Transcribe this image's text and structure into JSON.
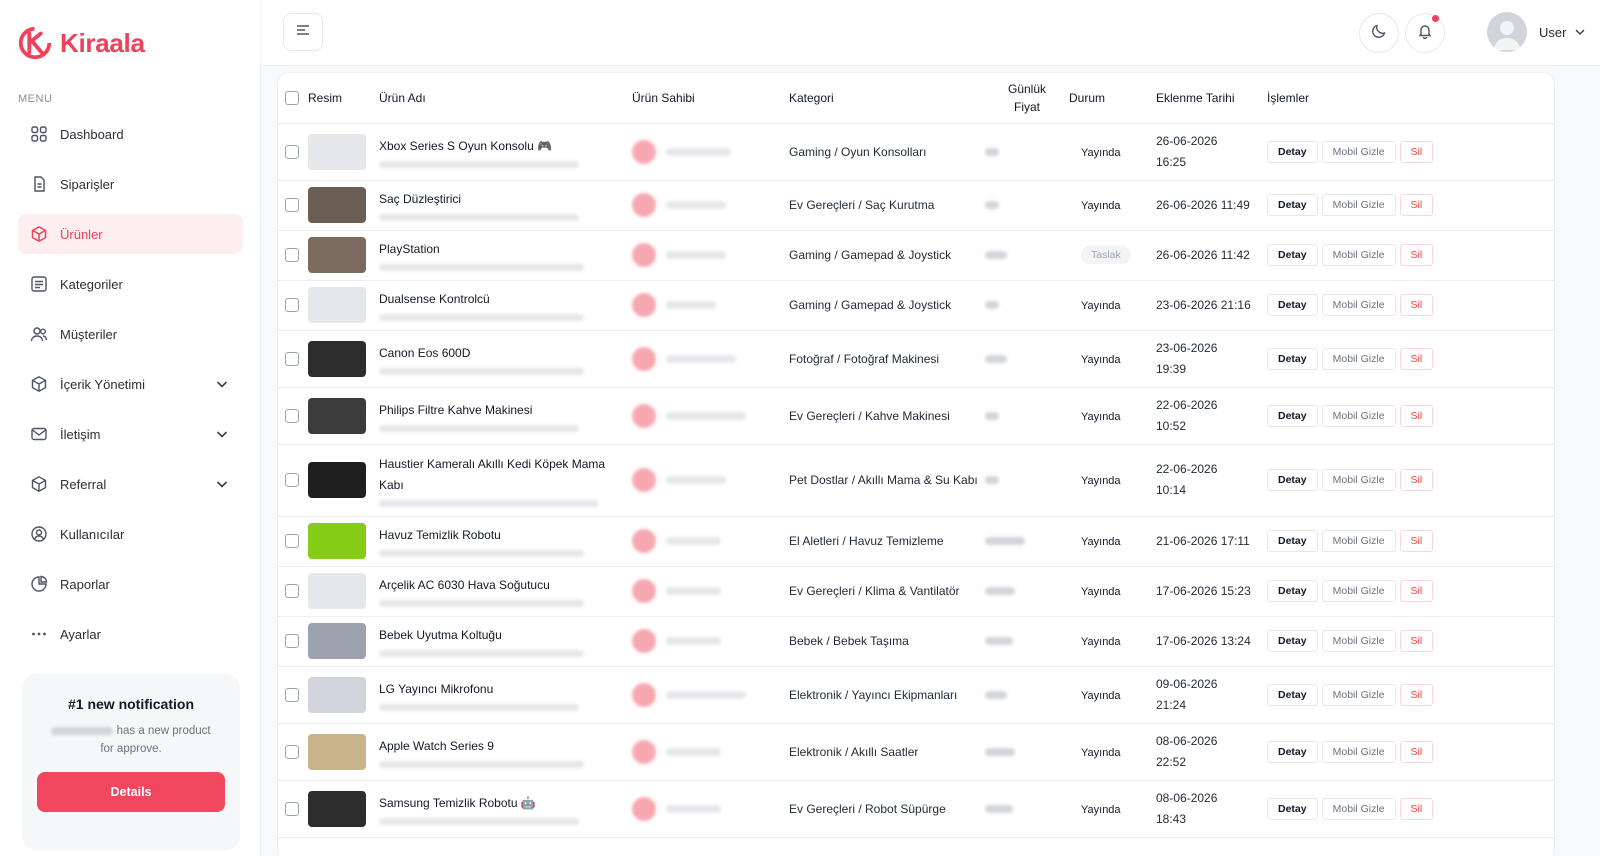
{
  "brand": {
    "name": "Kiraala",
    "color": "#f0405a"
  },
  "sidebar": {
    "caption": "MENU",
    "items": [
      {
        "label": "Dashboard",
        "icon": "grid-icon",
        "active": false,
        "expandable": false
      },
      {
        "label": "Siparişler",
        "icon": "clipboard-icon",
        "active": false,
        "expandable": false
      },
      {
        "label": "Ürünler",
        "icon": "box-icon",
        "active": true,
        "expandable": false
      },
      {
        "label": "Kategoriler",
        "icon": "list-icon",
        "active": false,
        "expandable": false
      },
      {
        "label": "Müşteriler",
        "icon": "users-icon",
        "active": false,
        "expandable": false
      },
      {
        "label": "İçerik Yönetimi",
        "icon": "cube-icon",
        "active": false,
        "expandable": true
      },
      {
        "label": "İletişim",
        "icon": "mail-icon",
        "active": false,
        "expandable": true
      },
      {
        "label": "Referral",
        "icon": "cube-icon",
        "active": false,
        "expandable": true
      },
      {
        "label": "Kullanıcılar",
        "icon": "user-circle-icon",
        "active": false,
        "expandable": false
      },
      {
        "label": "Raporlar",
        "icon": "pie-chart-icon",
        "active": false,
        "expandable": false
      },
      {
        "label": "Ayarlar",
        "icon": "more-dots-icon",
        "active": false,
        "expandable": false
      }
    ],
    "notification": {
      "title": "#1 new notification",
      "body_text": "has a new product",
      "body_text2": "for approve.",
      "button": "Details"
    }
  },
  "header": {
    "user_name": "User"
  },
  "table": {
    "columns": {
      "resim": "Resim",
      "urun_adi": "Ürün Adı",
      "urun_sahibi": "Ürün Sahibi",
      "kategori": "Kategori",
      "fiyat_line1": "Günlük",
      "fiyat_line2": "Fiyat",
      "durum": "Durum",
      "tarih": "Eklenme Tarihi",
      "islemler": "İşlemler"
    },
    "actions": {
      "detay": "Detay",
      "gizle": "Mobil Gizle",
      "sil": "Sil"
    },
    "rows": [
      {
        "name": "Xbox Series S Oyun Konsolu 🎮",
        "category": "Gaming / Oyun Konsolları",
        "status": "Yayında",
        "date1": "26-06-2026",
        "date2": "16:25",
        "thumb": "#e5e7eb"
      },
      {
        "name": "Saç Düzleştirici",
        "category": "Ev Gereçleri / Saç Kurutma",
        "status": "Yayında",
        "date1": "26-06-2026 11:49",
        "date2": "",
        "thumb": "#6b5e54"
      },
      {
        "name": "PlayStation",
        "category": "Gaming / Gamepad & Joystick",
        "status": "Taslak",
        "date1": "26-06-2026 11:42",
        "date2": "",
        "thumb": "#7b6a5e"
      },
      {
        "name": "Dualsense Kontrolcü",
        "category": "Gaming / Gamepad & Joystick",
        "status": "Yayında",
        "date1": "23-06-2026 21:16",
        "date2": "",
        "thumb": "#e5e7eb"
      },
      {
        "name": "Canon Eos 600D",
        "category": "Fotoğraf / Fotoğraf Makinesi",
        "status": "Yayında",
        "date1": "23-06-2026",
        "date2": "19:39",
        "thumb": "#2d2d2d"
      },
      {
        "name": "Philips Filtre Kahve Makinesi",
        "category": "Ev Gereçleri / Kahve Makinesi",
        "status": "Yayında",
        "date1": "22-06-2026",
        "date2": "10:52",
        "thumb": "#3b3b3b"
      },
      {
        "name": "Haustier Kameralı Akıllı Kedi Köpek Mama Kabı",
        "category": "Pet Dostlar / Akıllı Mama & Su Kabı",
        "status": "Yayında",
        "date1": "22-06-2026",
        "date2": "10:14",
        "thumb": "#1f1f1f"
      },
      {
        "name": "Havuz Temizlik Robotu",
        "category": "El Aletleri / Havuz Temizleme",
        "status": "Yayında",
        "date1": "21-06-2026 17:11",
        "date2": "",
        "thumb": "#84cc16"
      },
      {
        "name": "Arçelik AC 6030 Hava Soğutucu",
        "category": "Ev Gereçleri / Klima & Vantilatör",
        "status": "Yayında",
        "date1": "17-06-2026 15:23",
        "date2": "",
        "thumb": "#e5e7eb"
      },
      {
        "name": "Bebek Uyutma Koltuğu",
        "category": "Bebek / Bebek Taşıma",
        "status": "Yayında",
        "date1": "17-06-2026 13:24",
        "date2": "",
        "thumb": "#9ca3af"
      },
      {
        "name": "LG Yayıncı Mikrofonu",
        "category": "Elektronik / Yayıncı Ekipmanları",
        "status": "Yayında",
        "date1": "09-06-2026",
        "date2": "21:24",
        "thumb": "#d1d5db"
      },
      {
        "name": "Apple Watch Series 9",
        "category": "Elektronik / Akıllı Saatler",
        "status": "Yayında",
        "date1": "08-06-2026",
        "date2": "22:52",
        "thumb": "#c8b48a"
      },
      {
        "name": "Samsung Temizlik Robotu 🤖",
        "category": "Ev Gereçleri / Robot Süpürge",
        "status": "Yayında",
        "date1": "08-06-2026",
        "date2": "18:43",
        "thumb": "#2d2d2d"
      }
    ]
  }
}
